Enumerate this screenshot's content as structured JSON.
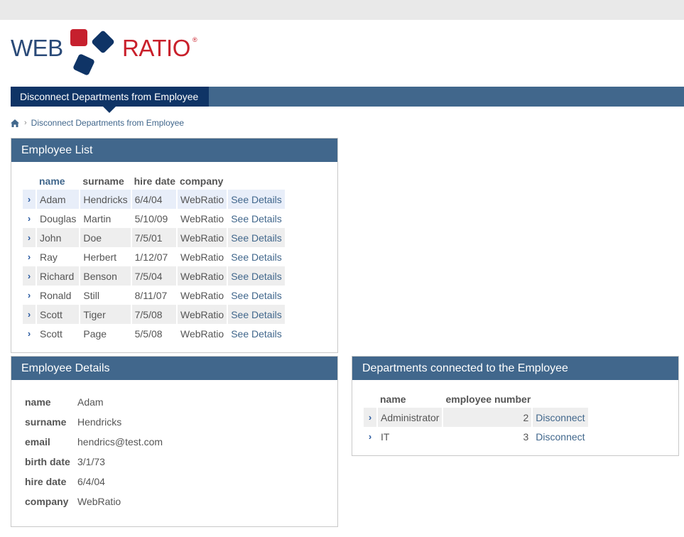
{
  "logo": {
    "web": "WEB",
    "ratio": "RATIO",
    "reg": "®"
  },
  "nav": {
    "active_tab": "Disconnect Departments from Employee"
  },
  "breadcrumb": {
    "current": "Disconnect Departments from Employee"
  },
  "employee_list": {
    "title": "Employee List",
    "columns": [
      "name",
      "surname",
      "hire date",
      "company"
    ],
    "link_label": "See Details",
    "rows": [
      {
        "name": "Adam",
        "surname": "Hendricks",
        "hire_date": "6/4/04",
        "company": "WebRatio"
      },
      {
        "name": "Douglas",
        "surname": "Martin",
        "hire_date": "5/10/09",
        "company": "WebRatio"
      },
      {
        "name": "John",
        "surname": "Doe",
        "hire_date": "7/5/01",
        "company": "WebRatio"
      },
      {
        "name": "Ray",
        "surname": "Herbert",
        "hire_date": "1/12/07",
        "company": "WebRatio"
      },
      {
        "name": "Richard",
        "surname": "Benson",
        "hire_date": "7/5/04",
        "company": "WebRatio"
      },
      {
        "name": "Ronald",
        "surname": "Still",
        "hire_date": "8/11/07",
        "company": "WebRatio"
      },
      {
        "name": "Scott",
        "surname": "Tiger",
        "hire_date": "7/5/08",
        "company": "WebRatio"
      },
      {
        "name": "Scott",
        "surname": "Page",
        "hire_date": "5/5/08",
        "company": "WebRatio"
      }
    ]
  },
  "employee_details": {
    "title": "Employee Details",
    "fields": [
      {
        "label": "name",
        "value": "Adam"
      },
      {
        "label": "surname",
        "value": "Hendricks"
      },
      {
        "label": "email",
        "value": "hendrics@test.com"
      },
      {
        "label": "birth date",
        "value": "3/1/73"
      },
      {
        "label": "hire date",
        "value": "6/4/04"
      },
      {
        "label": "company",
        "value": "WebRatio"
      }
    ]
  },
  "departments": {
    "title": "Departments connected to the Employee",
    "columns": [
      "name",
      "employee number"
    ],
    "link_label": "Disconnect",
    "rows": [
      {
        "name": "Administrator",
        "employee_number": "2"
      },
      {
        "name": "IT",
        "employee_number": "3"
      }
    ]
  },
  "colors": {
    "header_blue": "#41678c",
    "dark_blue": "#0f3466",
    "logo_red": "#c9202b"
  }
}
